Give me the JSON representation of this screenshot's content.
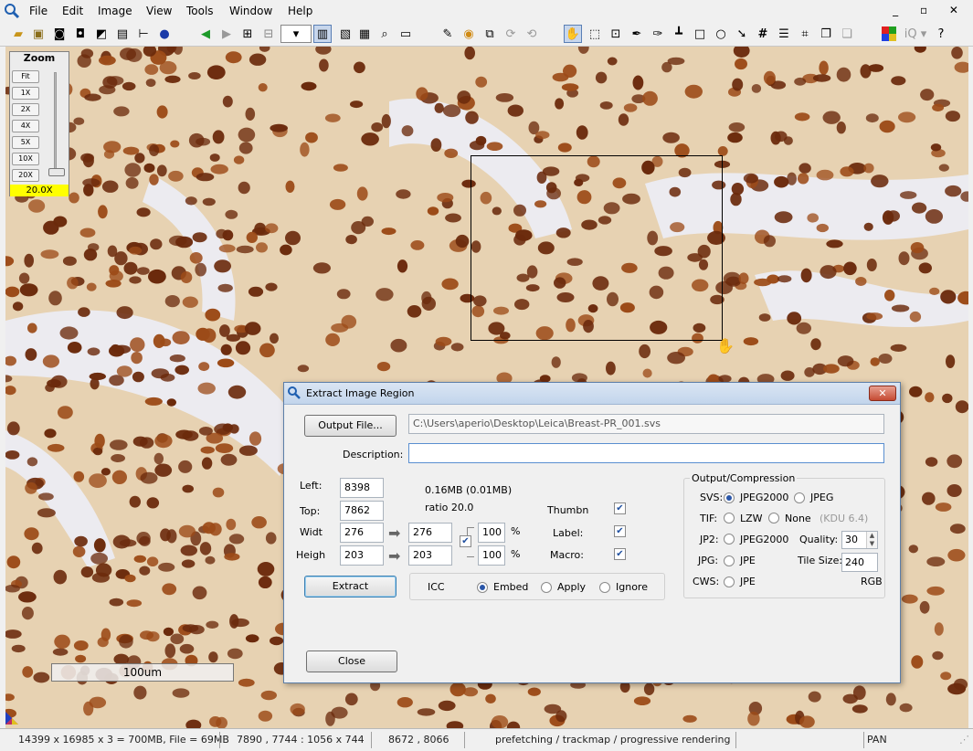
{
  "menu": [
    "File",
    "Edit",
    "Image",
    "View",
    "Tools",
    "Window",
    "Help"
  ],
  "window_controls": "_ ▫ ✕",
  "zoom": {
    "title": "Zoom",
    "buttons": [
      "Fit",
      "1X",
      "2X",
      "4X",
      "5X",
      "10X",
      "20X"
    ],
    "current": "20.0X",
    "current_bg": "#ffff00"
  },
  "scalebar": "100um",
  "dialog": {
    "title": "Extract Image Region",
    "output_button": "Output File...",
    "output_path": "C:\\Users\\aperio\\Desktop\\Leica\\Breast-PR_001.svs",
    "description_label": "Description:",
    "description_value": "",
    "left_label": "Left:",
    "left_value": "8398",
    "top_label": "Top:",
    "top_value": "7862",
    "width_label": "Widt",
    "width_value": "276",
    "width_out": "276",
    "height_label": "Heigh",
    "height_value": "203",
    "height_out": "203",
    "size_info": "0.16MB (0.01MB)",
    "ratio_info": "ratio 20.0",
    "pct_w": "100",
    "pct_h": "100",
    "pct_sign": "%",
    "thumb_label": "Thumbn",
    "label_label": "Label:",
    "macro_label": "Macro:",
    "extract_button": "Extract",
    "icc_label": "ICC",
    "icc_options": [
      "Embed",
      "Apply",
      "Ignore"
    ],
    "icc_selected": "Embed",
    "output_group": "Output/Compression",
    "svs_label": "SVS:",
    "svs_opt1": "JPEG2000",
    "svs_opt2": "JPEG",
    "tif_label": "TIF:",
    "tif_opt1": "LZW",
    "tif_opt2": "None",
    "kdu": "(KDU 6.4)",
    "jp2_label": "JP2:",
    "jp2_opt": "JPEG2000",
    "quality_label": "Quality:",
    "quality_value": "30",
    "jpg_label": "JPG:",
    "jpg_opt": "JPE",
    "tile_label": "Tile Size:",
    "tile_value": "240",
    "cws_label": "CWS:",
    "cws_opt": "JPE",
    "rgb": "RGB",
    "close_button": "Close"
  },
  "status": {
    "image_info": "14399 x 16985 x 3 = 700MB, File = 69MB",
    "view_info": "7890 , 7744 : 1056 x 744",
    "cursor": "8672 , 8066",
    "state": "prefetching / trackmap / progressive rendering",
    "mode": "PAN"
  },
  "colors": {
    "cell_dark": "#6b2a0c",
    "cell_mid": "#9c4b18",
    "stroma": "#ecebf0",
    "bg": "#e7d2b2"
  }
}
